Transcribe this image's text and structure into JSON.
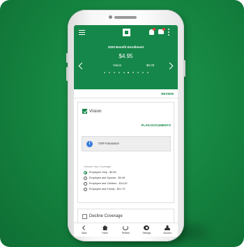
{
  "header": {
    "title": "2020 Benefit Enrollment",
    "price": "$4.95",
    "plan_name": "Vision",
    "plan_price": "$0.00"
  },
  "review_link": "REVIEW",
  "vision_card": {
    "label": "Vision",
    "checked": true,
    "plan_documents_link": "PLAN DOCUMENTS",
    "provider": "VSP Insurance",
    "choose_label": "Choose Your Coverage",
    "options": [
      {
        "label": "Employee Only - $4.95",
        "selected": true
      },
      {
        "label": "Employee and Spouse - $9.45",
        "selected": false
      },
      {
        "label": "Employee and Children - $14.40",
        "selected": false
      },
      {
        "label": "Employee and Family - $21.70",
        "selected": false
      }
    ]
  },
  "decline": {
    "label": "Decline Coverage",
    "checked": false
  },
  "tabs": [
    {
      "label": "Back",
      "icon": "back-icon"
    },
    {
      "label": "Home",
      "icon": "home-icon"
    },
    {
      "label": "Refresh",
      "icon": "refresh-icon"
    },
    {
      "label": "Settings",
      "icon": "gear-icon"
    },
    {
      "label": "Account",
      "icon": "user-icon"
    }
  ],
  "colors": {
    "brand": "#16874a",
    "background": "#14823f",
    "info": "#3b7ddd",
    "badge": "#e53935"
  }
}
